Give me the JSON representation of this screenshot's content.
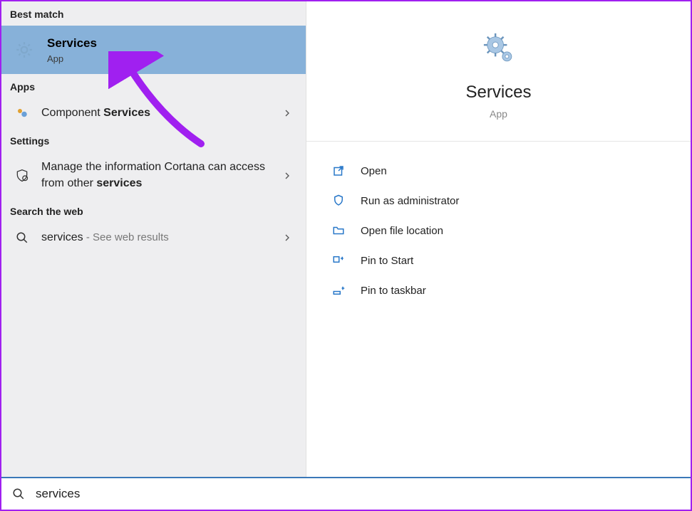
{
  "left": {
    "best_match": {
      "header": "Best match",
      "title": "Services",
      "subtitle": "App"
    },
    "apps": {
      "header": "Apps",
      "items": [
        {
          "text_pre": "Component ",
          "text_bold": "Services"
        }
      ]
    },
    "settings": {
      "header": "Settings",
      "items": [
        {
          "text_pre": "Manage the information Cortana can access from other ",
          "text_bold": "services"
        }
      ]
    },
    "web": {
      "header": "Search the web",
      "items": [
        {
          "term": "services",
          "suffix": " - See web results"
        }
      ]
    }
  },
  "right": {
    "title": "Services",
    "subtitle": "App",
    "actions": [
      {
        "label": "Open",
        "icon": "open"
      },
      {
        "label": "Run as administrator",
        "icon": "admin"
      },
      {
        "label": "Open file location",
        "icon": "folder"
      },
      {
        "label": "Pin to Start",
        "icon": "pin-start"
      },
      {
        "label": "Pin to taskbar",
        "icon": "pin-taskbar"
      }
    ]
  },
  "search": {
    "query": "services"
  },
  "icons": {
    "gear": "gear",
    "component": "component",
    "shield": "shield",
    "search": "search",
    "chevron": "›"
  },
  "annotation": {
    "color": "#a020f0"
  }
}
